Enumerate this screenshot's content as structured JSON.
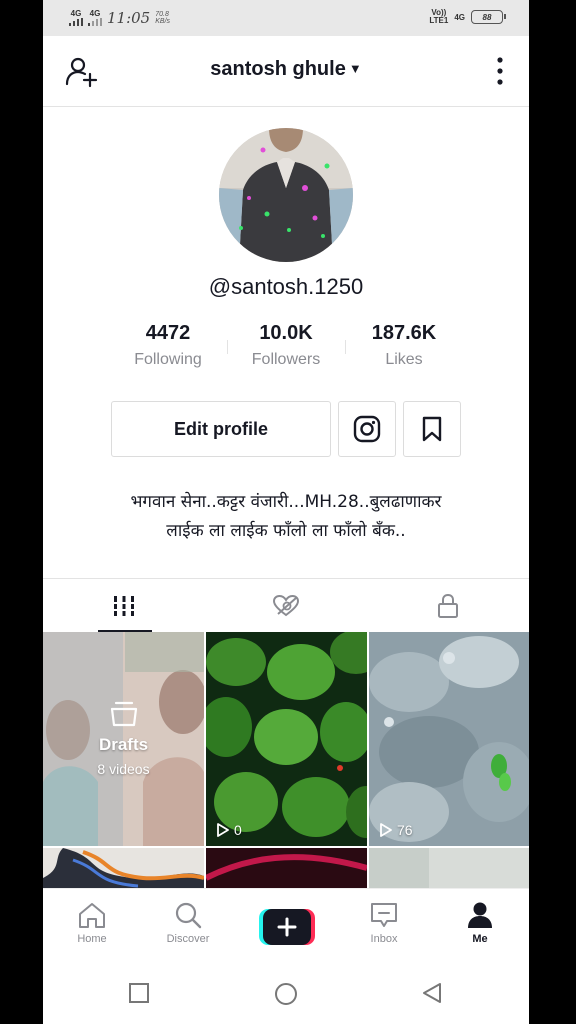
{
  "status_bar": {
    "net1": "4G",
    "net2": "4G",
    "time": "11:05",
    "speed_value": "70.8",
    "speed_unit": "KB/s",
    "volte_top": "Vo))",
    "volte_bottom": "LTE1",
    "net3": "4G",
    "battery": "88"
  },
  "header": {
    "title": "santosh ghule",
    "add_user_icon": "add-user-icon",
    "more_icon": "more-vertical-icon"
  },
  "profile": {
    "handle": "@santosh.1250",
    "stats": [
      {
        "value": "4472",
        "label": "Following"
      },
      {
        "value": "10.0K",
        "label": "Followers"
      },
      {
        "value": "187.6K",
        "label": "Likes"
      }
    ],
    "edit_label": "Edit profile",
    "bio_line1": "भगवान सेना..कट्टर वंजारी...MH.28..बुलढाणाकर",
    "bio_line2": "लाईक ला लाईक फॉंलो ला फॉंलो बॅंक.."
  },
  "tabs": [
    {
      "icon": "grid-icon",
      "active": true
    },
    {
      "icon": "liked-hidden-icon",
      "active": false
    },
    {
      "icon": "lock-icon",
      "active": false
    }
  ],
  "videos": {
    "drafts_title": "Drafts",
    "drafts_count": "8 videos",
    "video1_views": "0",
    "video2_views": "76"
  },
  "bottom_nav": [
    {
      "label": "Home",
      "icon": "home-icon"
    },
    {
      "label": "Discover",
      "icon": "search-icon"
    },
    {
      "label": "",
      "icon": "create-plus-icon"
    },
    {
      "label": "Inbox",
      "icon": "inbox-icon"
    },
    {
      "label": "Me",
      "icon": "profile-icon"
    }
  ],
  "colors": {
    "text_primary": "#161823",
    "text_secondary": "#8a8b91",
    "create_left": "#25f4ee",
    "create_right": "#fe2c55"
  }
}
